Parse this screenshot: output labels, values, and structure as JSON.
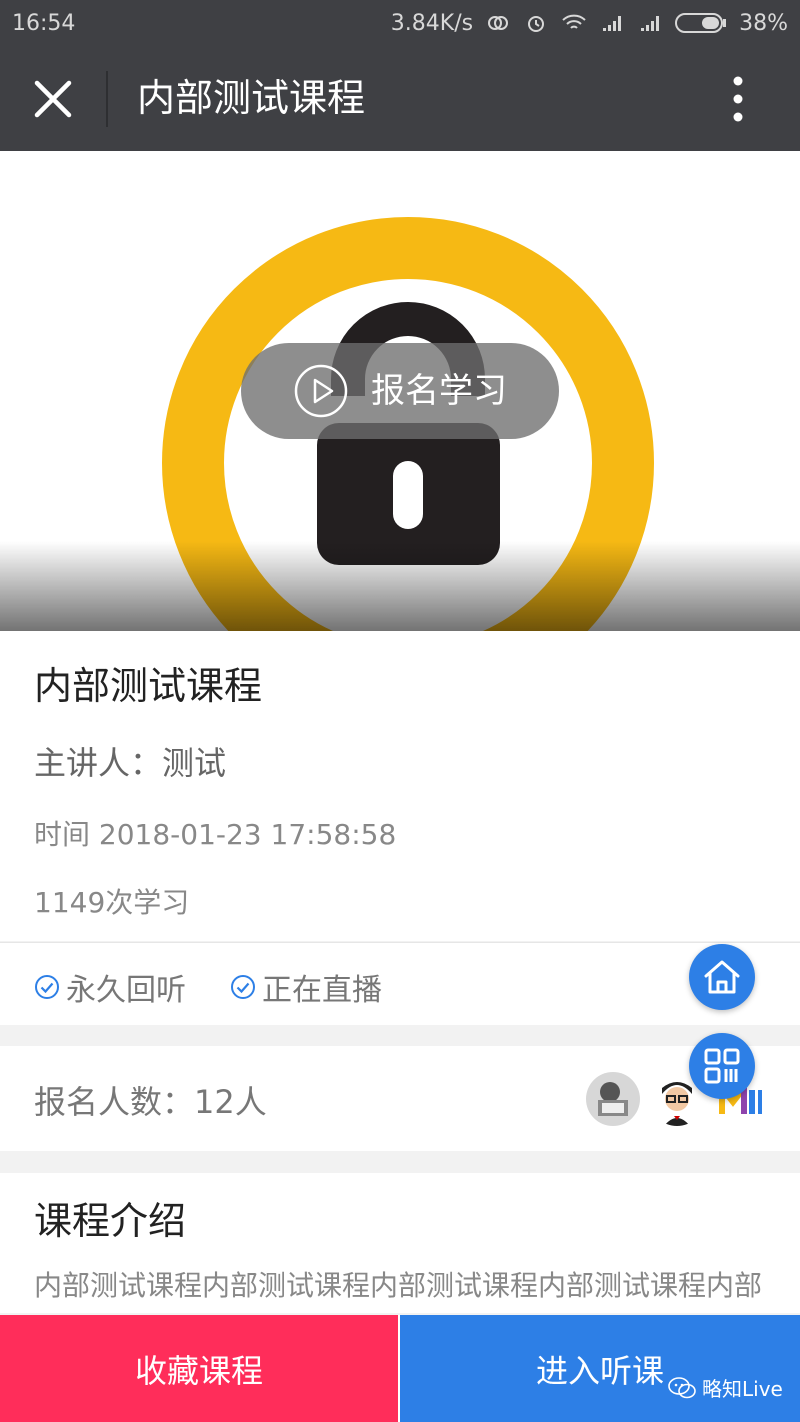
{
  "status_bar": {
    "time": "16:54",
    "network_speed": "3.84K/s",
    "battery": "38%",
    "icons": [
      "sync-icon",
      "alarm-icon",
      "wifi-icon",
      "signal-icon",
      "signal-icon",
      "battery-icon"
    ]
  },
  "title_bar": {
    "title": "内部测试课程",
    "close_icon": "close-icon",
    "more_icon": "more-vertical-icon"
  },
  "hero": {
    "cta_label": "报名学习",
    "play_icon": "play-icon",
    "lock_icon": "lock-icon",
    "colors": {
      "ring": "#f6b914",
      "lock": "#231f20"
    }
  },
  "course": {
    "name": "内部测试课程",
    "speaker": "主讲人：测试",
    "time": "时间 2018-01-23 17:58:58",
    "views": "1149次学习"
  },
  "tags": [
    {
      "label": "永久回听",
      "icon": "check-circle-icon"
    },
    {
      "label": "正在直播",
      "icon": "check-circle-icon"
    }
  ],
  "enrollment": {
    "count_text": "报名人数：12人",
    "avatars": [
      "avatar-robot",
      "avatar-person",
      "avatar-logo"
    ]
  },
  "intro": {
    "heading": "课程介绍",
    "body": "内部测试课程内部测试课程内部测试课程内部测试课程内部"
  },
  "floating": {
    "home_icon": "home-icon",
    "qrcode_icon": "qrcode-icon"
  },
  "bottom_bar": {
    "favorite_label": "收藏课程",
    "enter_label": "进入听课",
    "colors": {
      "favorite": "#ff2d5a",
      "enter": "#2d7fe6"
    }
  },
  "watermark": {
    "text": "略知Live",
    "icon": "wechat-icon"
  }
}
